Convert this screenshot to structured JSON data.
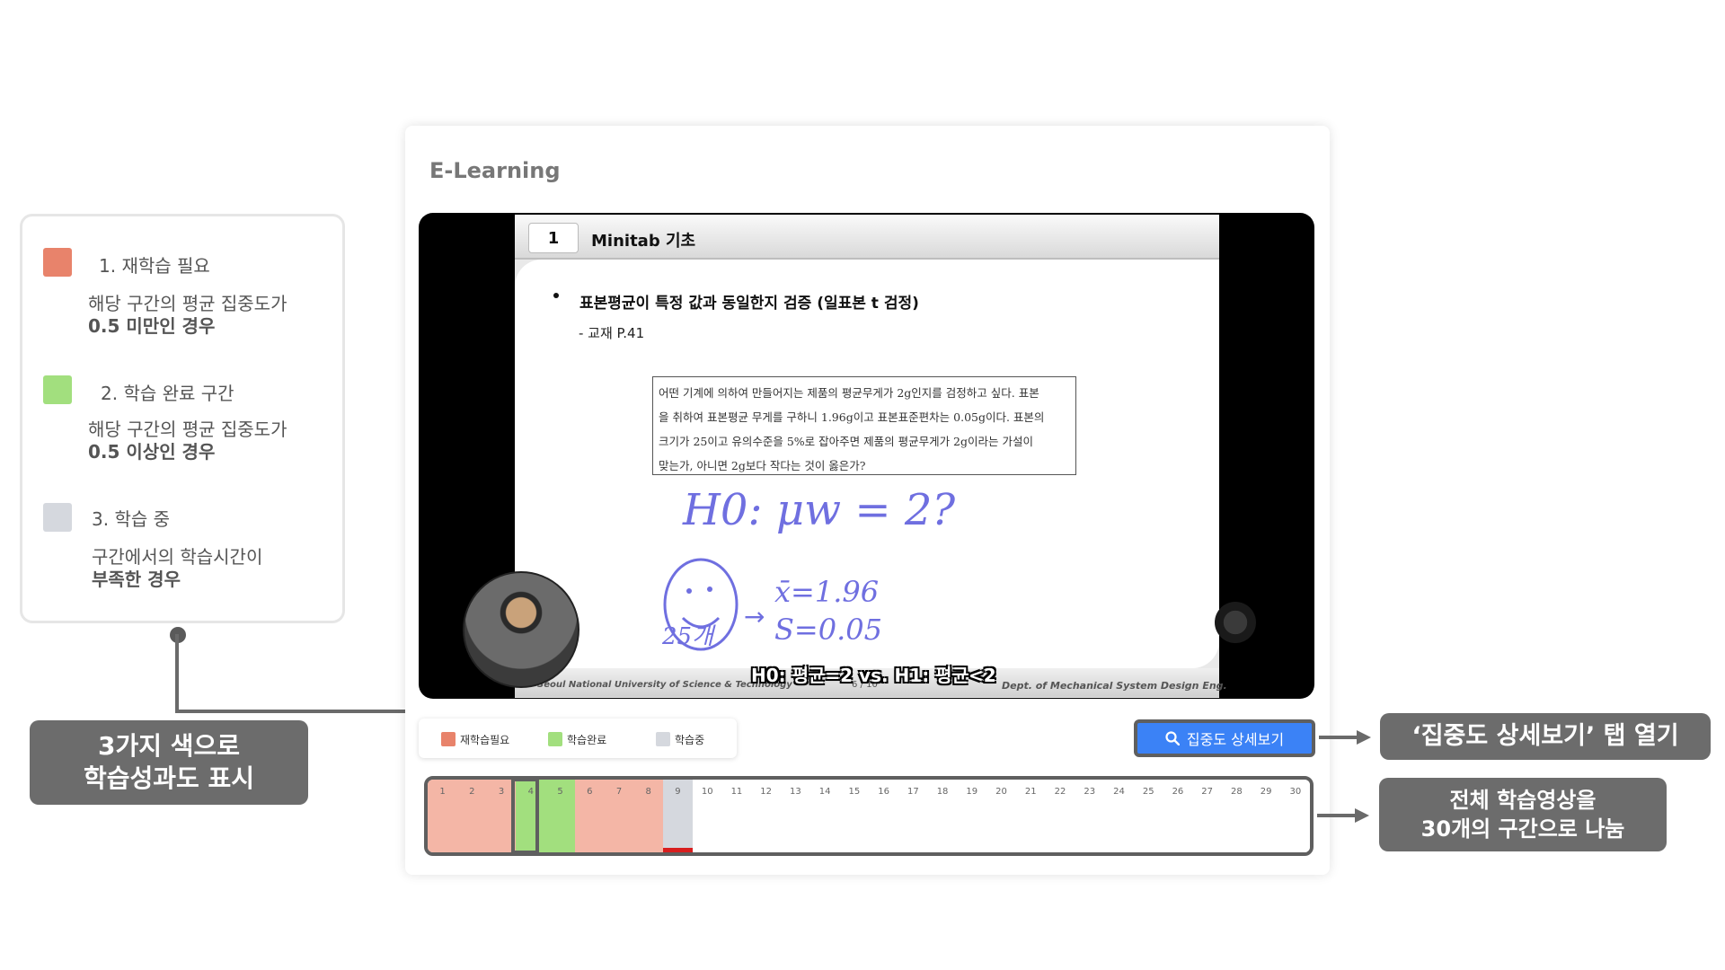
{
  "legend_panel": {
    "items": [
      {
        "title": "1. 재학습 필요",
        "desc_line1": "해당 구간의 평균 집중도가",
        "desc_line2": "0.5 미만인 경우",
        "color": "#e8836b"
      },
      {
        "title": "2. 학습 완료 구간",
        "desc_line1": "해당 구간의 평균 집중도가",
        "desc_line2": "0.5 이상인 경우",
        "color": "#a2df7e"
      },
      {
        "title": "3. 학습 중",
        "desc_line1": "구간에서의 학습시간이",
        "desc_line2": "부족한 경우",
        "color": "#d5d8de"
      }
    ]
  },
  "callouts": {
    "color_callout_line1": "3가지 색으로",
    "color_callout_line2": "학습성과도 표시",
    "tab_callout": "‘집중도 상세보기’ 탭 열기",
    "segments_callout_line1": "전체 학습영상을",
    "segments_callout_line2": "30개의 구간으로 나눔"
  },
  "app": {
    "title": "E-Learning"
  },
  "video": {
    "slide_number": "1",
    "slide_title": "Minitab 기초",
    "bullet": "표본평균이 특정 값과 동일한지 검증 (일표본 t 검정)",
    "reference": "- 교재 P.41",
    "problem_lines": [
      "어떤 기계에 의하여 만들어지는 제품의 평균무게가 2g인지를 검정하고 싶다. 표본",
      "을 취하여 표본평균 무게를 구하니 1.96g이고 표본표준편차는 0.05g이다. 표본의",
      "크기가 25이고 유의수준을 5%로 잡아주면 제품의 평균무게가 2g이라는 가설이",
      "맞는가, 아니면 2g보다 작다는 것이 옳은가?"
    ],
    "handwriting_line1": "H0: μw = 2?",
    "handwriting_xbar": "x̄=1.96",
    "handwriting_s": "S=0.05",
    "handwriting_n": "25개",
    "subtitle": "H0: 평균=2 vs. H1: 평균<2",
    "footer_left": "Seoul National University of Science & Technology",
    "footer_page": "6 / 10",
    "footer_right": "Dept. of Mechanical System Design Eng."
  },
  "status_legend": {
    "items": [
      {
        "label": "재학습필요",
        "color": "#e8836b"
      },
      {
        "label": "학습완료",
        "color": "#a2df7e"
      },
      {
        "label": "학습중",
        "color": "#d5d8de"
      }
    ]
  },
  "detail_button": {
    "label": "집중도 상세보기",
    "icon": "search-icon"
  },
  "timeline": {
    "segments": [
      {
        "label": "1",
        "status": "relearn"
      },
      {
        "label": "2",
        "status": "relearn"
      },
      {
        "label": "3",
        "status": "relearn"
      },
      {
        "label": "4",
        "status": "complete"
      },
      {
        "label": "5",
        "status": "complete"
      },
      {
        "label": "6",
        "status": "relearn"
      },
      {
        "label": "7",
        "status": "relearn"
      },
      {
        "label": "8",
        "status": "relearn"
      },
      {
        "label": "9",
        "status": "learning"
      },
      {
        "label": "10",
        "status": "none"
      },
      {
        "label": "11",
        "status": "none"
      },
      {
        "label": "12",
        "status": "none"
      },
      {
        "label": "13",
        "status": "none"
      },
      {
        "label": "14",
        "status": "none"
      },
      {
        "label": "15",
        "status": "none"
      },
      {
        "label": "16",
        "status": "none"
      },
      {
        "label": "17",
        "status": "none"
      },
      {
        "label": "18",
        "status": "none"
      },
      {
        "label": "19",
        "status": "none"
      },
      {
        "label": "20",
        "status": "none"
      },
      {
        "label": "21",
        "status": "none"
      },
      {
        "label": "22",
        "status": "none"
      },
      {
        "label": "23",
        "status": "none"
      },
      {
        "label": "24",
        "status": "none"
      },
      {
        "label": "25",
        "status": "none"
      },
      {
        "label": "26",
        "status": "none"
      },
      {
        "label": "27",
        "status": "none"
      },
      {
        "label": "28",
        "status": "none"
      },
      {
        "label": "29",
        "status": "none"
      },
      {
        "label": "30",
        "status": "none"
      }
    ],
    "status_colors": {
      "relearn": "#f4b6a6",
      "complete": "#a2df7e",
      "learning": "#d5d8de",
      "none": "#ffffff"
    },
    "playback_progress_segments": 9
  }
}
